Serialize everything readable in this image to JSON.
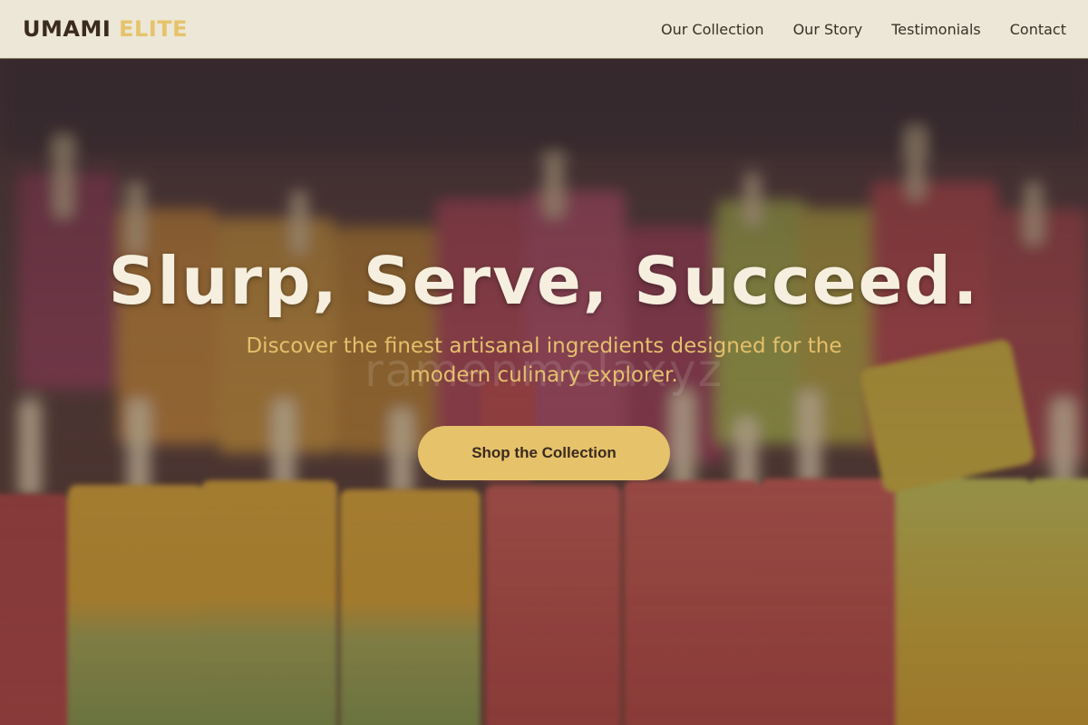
{
  "brand": {
    "word1": "UMAMI",
    "word2": "ELITE"
  },
  "nav": {
    "items": [
      {
        "label": "Our Collection"
      },
      {
        "label": "Our Story"
      },
      {
        "label": "Testimonials"
      },
      {
        "label": "Contact"
      }
    ]
  },
  "hero": {
    "headline": "Slurp, Serve, Succeed.",
    "subtitle": "Discover the finest artisanal ingredients designed for the modern culinary explorer.",
    "cta_label": "Shop the Collection",
    "watermark": "ramenmelaxyz"
  },
  "colors": {
    "accent": "#e6c36b",
    "header_bg": "#ece7d6",
    "dark_text": "#3b2a1f"
  }
}
